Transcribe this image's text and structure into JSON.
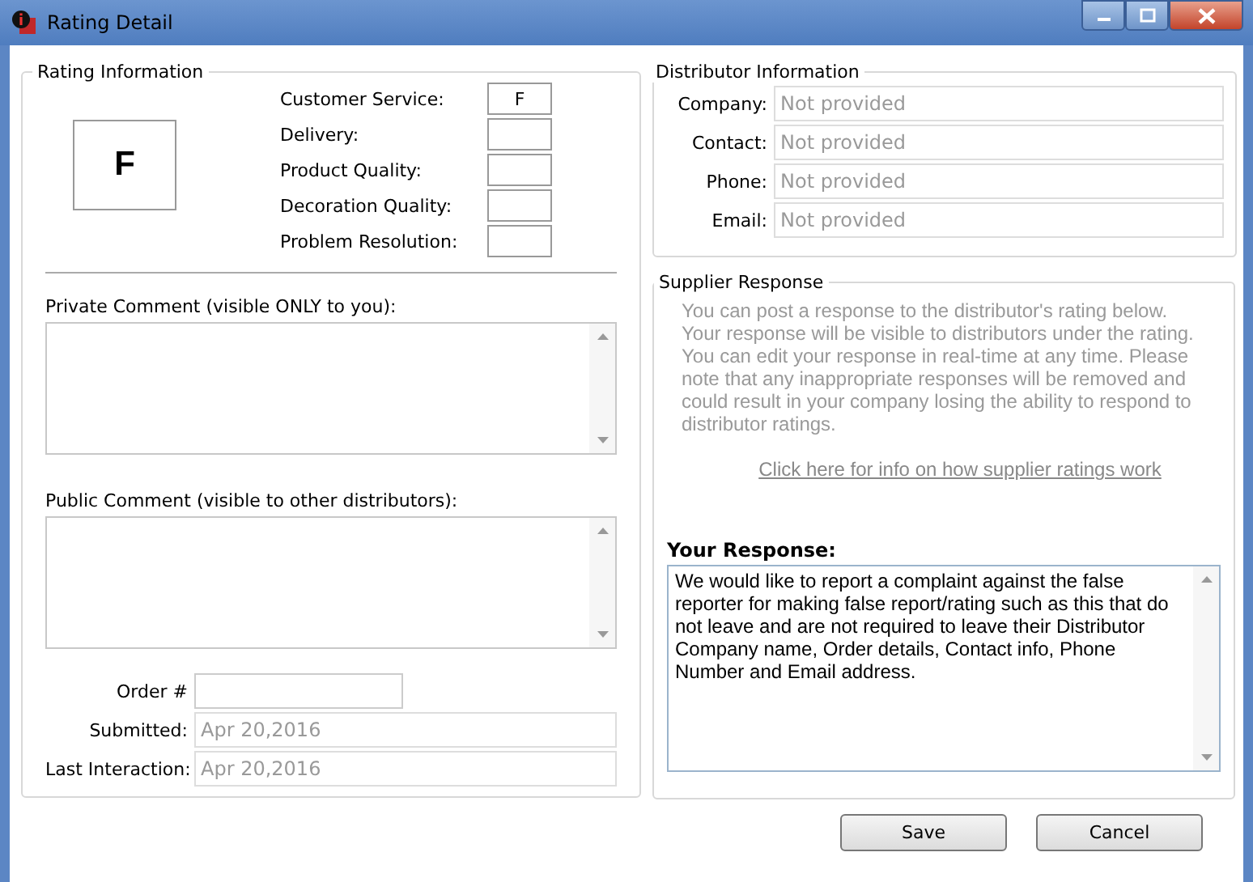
{
  "window": {
    "title": "Rating Detail"
  },
  "rating_information": {
    "title": "Rating Information",
    "overall_grade": "F",
    "categories": [
      {
        "label": "Customer Service:",
        "grade": "F"
      },
      {
        "label": "Delivery:"
      },
      {
        "label": "Product Quality:"
      },
      {
        "label": "Decoration Quality:"
      },
      {
        "label": "Problem Resolution:"
      }
    ],
    "private_comment": {
      "label": "Private Comment (visible ONLY to you):"
    },
    "public_comment": {
      "label": "Public Comment (visible to other distributors):"
    },
    "fields": [
      {
        "label": "Order #",
        "disabled": false,
        "kind": "short"
      },
      {
        "label": "Submitted:",
        "value": "Apr 20,2016",
        "disabled": true,
        "kind": "wide"
      },
      {
        "label": "Last Interaction:",
        "value": "Apr 20,2016",
        "disabled": true,
        "kind": "wide"
      }
    ]
  },
  "distributor_information": {
    "title": "Distributor Information",
    "fields": [
      {
        "label": "Company:",
        "value": "Not provided",
        "disabled": true
      },
      {
        "label": "Contact:",
        "value": "Not provided",
        "disabled": true
      },
      {
        "label": "Phone:",
        "value": "Not provided",
        "disabled": true
      },
      {
        "label": "Email:",
        "value": "Not provided",
        "disabled": true
      }
    ]
  },
  "supplier_response": {
    "title": "Supplier Response",
    "notice": "You can post a response to the distributor's rating below. Your response will be visible to distributors under the rating.  You can edit your response in real-time at any time.  Please note that any inappropriate responses will be removed and could result in your company losing the ability to respond to distributor ratings.",
    "link": "Click here for info on how supplier ratings work",
    "response_label": "Your Response:",
    "response_value": "We would like to report a complaint against the false reporter for making false report/rating such as this that do not leave and are not required to leave their Distributor Company name, Order details, Contact info, Phone Number and Email address."
  },
  "buttons": [
    "Save",
    "Cancel"
  ]
}
